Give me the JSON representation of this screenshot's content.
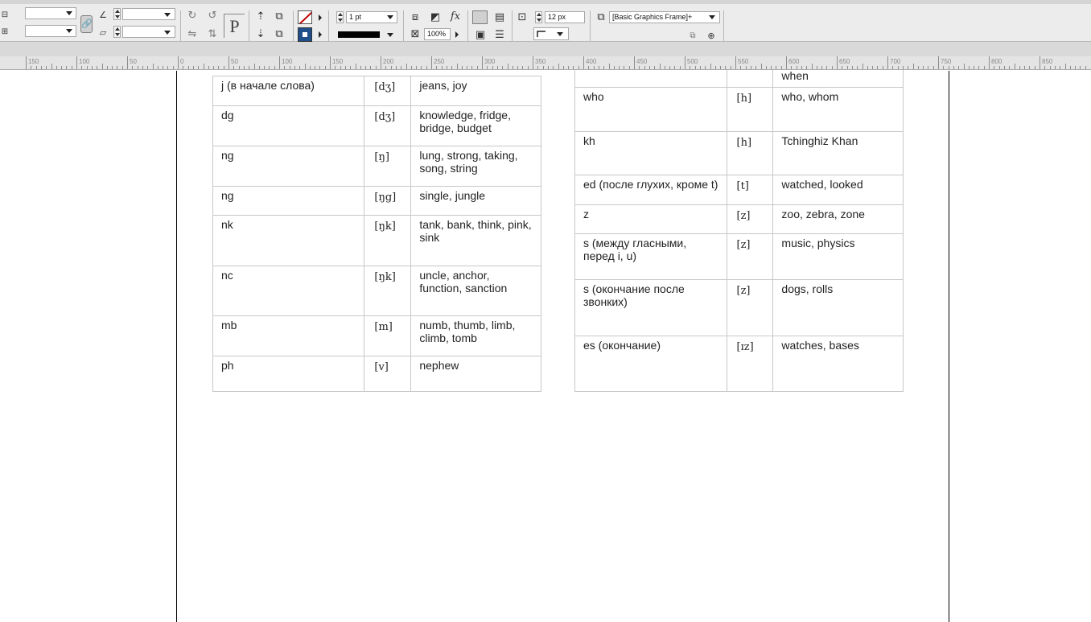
{
  "control_bar": {
    "stroke_weight": "1 pt",
    "opacity": "100%",
    "gap": "12 px",
    "object_style": "[Basic Graphics Frame]+"
  },
  "ruler": {
    "labels": [
      "150",
      "100",
      "50",
      "0",
      "50",
      "100",
      "150",
      "200",
      "250",
      "300",
      "350",
      "400",
      "450",
      "500",
      "550",
      "600",
      "650",
      "700",
      "750",
      "800",
      "850"
    ]
  },
  "left_table": {
    "rows": [
      {
        "letters": "j (в начале слова)",
        "sound": "[dʒ]",
        "examples": "jeans, joy"
      },
      {
        "letters": "dg",
        "sound": "[dʒ]",
        "examples": "knowledge, fridge, bridge, budget"
      },
      {
        "letters": "ng",
        "sound": "[ŋ]",
        "examples": "lung, strong, taking, song, string"
      },
      {
        "letters": "ng",
        "sound": "[ŋg]",
        "examples": "single, jungle"
      },
      {
        "letters": "nk",
        "sound": "[ŋk]",
        "examples": "tank, bank, think, pink, sink"
      },
      {
        "letters": "nc",
        "sound": "[ŋk]",
        "examples": "uncle, anchor, function, sanction"
      },
      {
        "letters": "mb",
        "sound": "[m]",
        "examples": "numb, thumb, limb, climb, tomb"
      },
      {
        "letters": "ph",
        "sound": "[v]",
        "examples": "nephew"
      }
    ]
  },
  "right_table": {
    "rows": [
      {
        "letters": "",
        "sound": "",
        "examples": "when"
      },
      {
        "letters": "who",
        "sound": "[h]",
        "examples": "who, whom"
      },
      {
        "letters": "kh",
        "sound": "[h]",
        "examples": "Tchinghiz Khan"
      },
      {
        "letters": "ed (после глухих, кроме t)",
        "sound": "[t]",
        "examples": "watched, looked"
      },
      {
        "letters": "z",
        "sound": "[z]",
        "examples": "zoo, zebra, zone"
      },
      {
        "letters": "s (между гласными, перед i, u)",
        "sound": "[z]",
        "examples": "music, physics"
      },
      {
        "letters": "s (окончание после звонких)",
        "sound": "[z]",
        "examples": "dogs, rolls"
      },
      {
        "letters": "es (окончание)",
        "sound": "[ɪz]",
        "examples": "watches, bases"
      }
    ]
  },
  "colors": {
    "fill_swatch": "#1f4f8a",
    "stroke_none": "#c00000"
  }
}
